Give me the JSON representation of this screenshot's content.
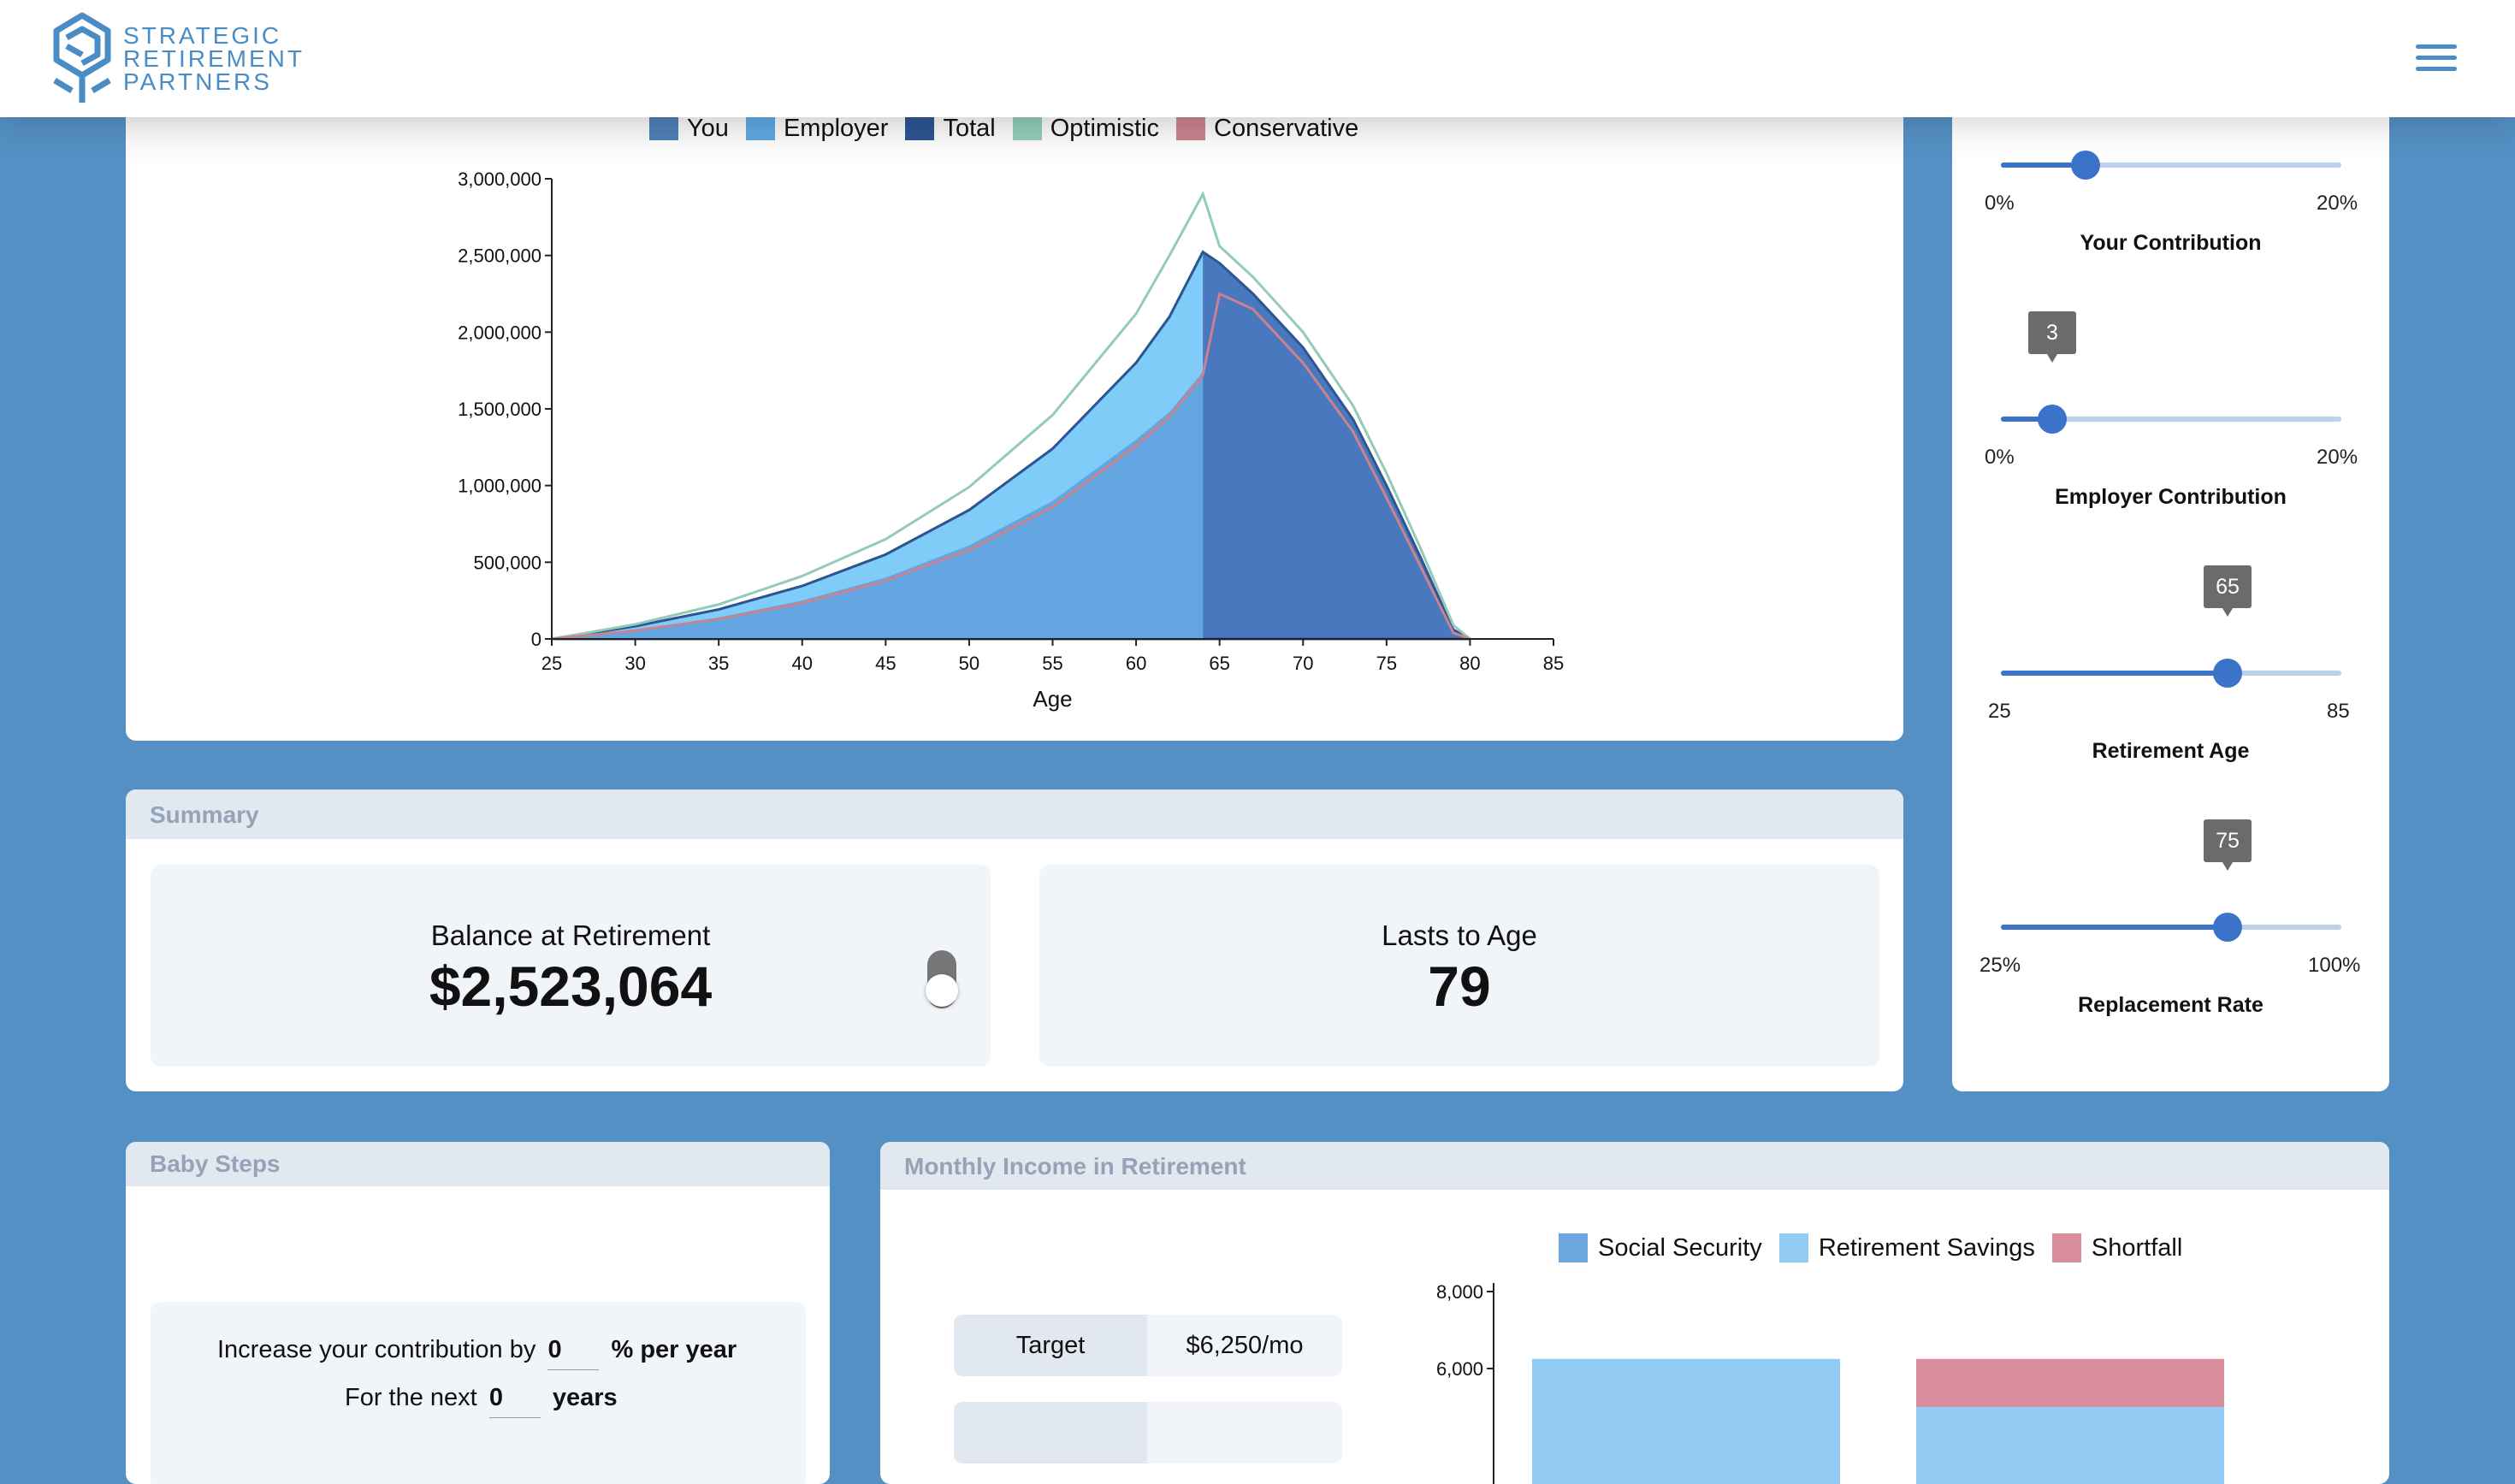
{
  "brand": {
    "line1": "STRATEGIC",
    "line2": "RETIREMENT",
    "line3": "PARTNERS",
    "color": "#4a8cc6"
  },
  "header": {
    "menu_icon": "hamburger-menu-icon"
  },
  "projection_chart": {
    "legend": [
      {
        "name": "You",
        "color": "#4e7fb7"
      },
      {
        "name": "Employer",
        "color": "#5fa8e2"
      },
      {
        "name": "Total",
        "color": "#2d5592"
      },
      {
        "name": "Optimistic",
        "color": "#92cbb8"
      },
      {
        "name": "Conservative",
        "color": "#c8838e"
      }
    ],
    "xlabel": "Age"
  },
  "chart_data": [
    {
      "type": "area",
      "title": "",
      "xlabel": "Age",
      "ylabel": "",
      "xlim": [
        25,
        85
      ],
      "ylim": [
        0,
        3000000
      ],
      "x_ticks": [
        25,
        30,
        35,
        40,
        45,
        50,
        55,
        60,
        65,
        70,
        75,
        80,
        85
      ],
      "y_ticks": [
        0,
        500000,
        1000000,
        1500000,
        2000000,
        2500000,
        3000000
      ],
      "y_tick_labels": [
        "0",
        "500,000",
        "1,000,000",
        "1,500,000",
        "2,000,000",
        "2,500,000",
        "3,000,000"
      ],
      "x": [
        25,
        30,
        35,
        40,
        45,
        50,
        55,
        60,
        62,
        64,
        65,
        67,
        70,
        73,
        75,
        77,
        79,
        80
      ],
      "series": [
        {
          "name": "You",
          "values": [
            0,
            60000,
            140000,
            250000,
            400000,
            610000,
            900000,
            1300000,
            1480000,
            1740000,
            null,
            null,
            null,
            null,
            null,
            null,
            null,
            null
          ]
        },
        {
          "name": "Employer",
          "values": [
            0,
            23000,
            52000,
            95000,
            150000,
            230000,
            340000,
            500000,
            620000,
            783064,
            null,
            null,
            null,
            null,
            null,
            null,
            null,
            null
          ]
        },
        {
          "name": "Total",
          "values": [
            0,
            83000,
            192000,
            345000,
            550000,
            840000,
            1240000,
            1800000,
            2100000,
            2523064,
            2450000,
            2250000,
            1900000,
            1430000,
            1000000,
            540000,
            60000,
            0
          ]
        },
        {
          "name": "Optimistic",
          "values": [
            0,
            95000,
            225000,
            410000,
            650000,
            990000,
            1460000,
            2120000,
            2500000,
            2900000,
            2560000,
            2360000,
            2000000,
            1520000,
            1080000,
            600000,
            90000,
            0
          ]
        },
        {
          "name": "Conservative",
          "values": [
            0,
            55000,
            130000,
            235000,
            380000,
            580000,
            860000,
            1260000,
            1450000,
            1720000,
            2250000,
            2150000,
            1800000,
            1350000,
            920000,
            480000,
            40000,
            0
          ]
        }
      ]
    },
    {
      "type": "bar",
      "title": "Monthly Income in Retirement",
      "y_ticks": [
        6000,
        8000
      ],
      "y_tick_labels": [
        "6,000",
        "8,000"
      ],
      "categories": [
        "",
        ""
      ],
      "series": [
        {
          "name": "Social Security",
          "values": [
            null,
            null
          ]
        },
        {
          "name": "Retirement Savings",
          "values": [
            6250,
            5000
          ]
        },
        {
          "name": "Shortfall",
          "values": [
            0,
            1250
          ]
        }
      ]
    }
  ],
  "summary": {
    "title": "Summary",
    "balance_label": "Balance at Retirement",
    "balance_value": "$2,523,064",
    "lasts_label": "Lasts to Age",
    "lasts_value": "79"
  },
  "sliders": [
    {
      "id": "your-contribution",
      "label": "Your Contribution",
      "min": "0%",
      "max": "20%",
      "value_fraction": 0.25
    },
    {
      "id": "employer-contribution",
      "label": "Employer Contribution",
      "min": "0%",
      "max": "20%",
      "value": "3",
      "value_fraction": 0.15
    },
    {
      "id": "retirement-age",
      "label": "Retirement Age",
      "min": "25",
      "max": "85",
      "value": "65",
      "value_fraction": 0.667
    },
    {
      "id": "replacement-rate",
      "label": "Replacement Rate",
      "min": "25%",
      "max": "100%",
      "value": "75",
      "value_fraction": 0.667
    }
  ],
  "baby_steps": {
    "title": "Baby Steps",
    "line1_prefix": "Increase your contribution by",
    "line1_value": "0",
    "line1_suffix": "% per year",
    "line2_prefix": "For the next",
    "line2_value": "0",
    "line2_suffix": "years"
  },
  "income": {
    "title": "Monthly Income in Retirement",
    "target_label": "Target",
    "target_value": "$6,250/mo",
    "legend": [
      {
        "name": "Social Security",
        "color": "#6ea6e0"
      },
      {
        "name": "Retirement Savings",
        "color": "#92cbf4"
      },
      {
        "name": "Shortfall",
        "color": "#d98e9e"
      }
    ]
  }
}
